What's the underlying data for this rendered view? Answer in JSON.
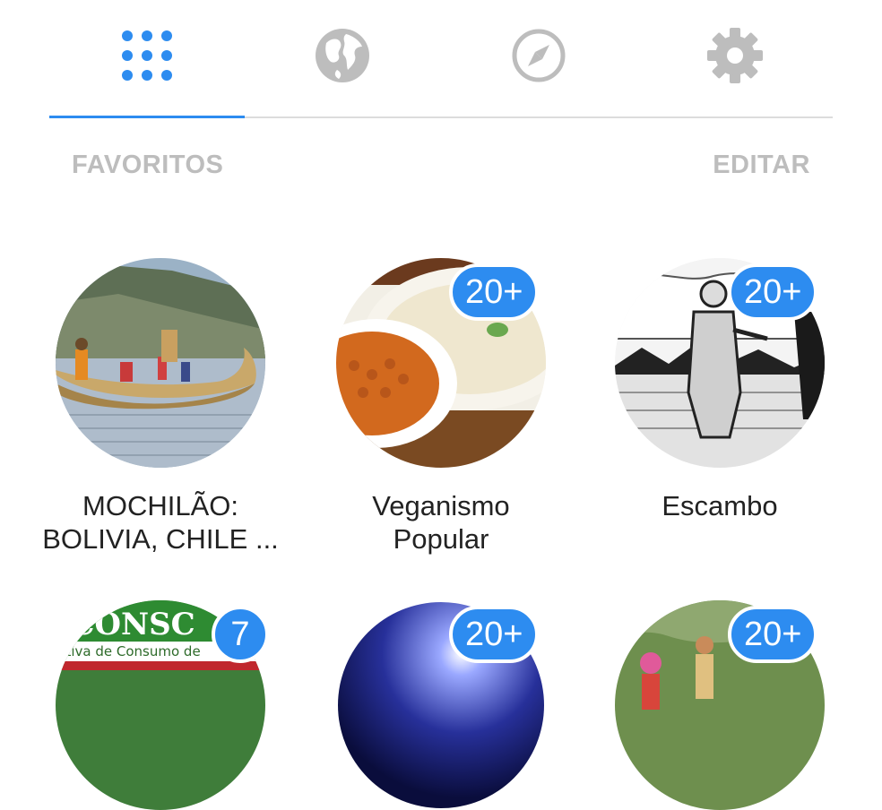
{
  "tabs": [
    {
      "name": "apps",
      "icon": "grid-icon",
      "active": true
    },
    {
      "name": "globe",
      "icon": "globe-icon",
      "active": false
    },
    {
      "name": "compass",
      "icon": "compass-icon",
      "active": false
    },
    {
      "name": "settings",
      "icon": "gear-icon",
      "active": false
    }
  ],
  "colors": {
    "accent": "#2d8cf0",
    "inactive_icon": "#bdbdbd",
    "section_header": "#bdbdbd",
    "text": "#222222"
  },
  "section": {
    "title": "FAVORITOS",
    "edit_label": "EDITAR"
  },
  "groups": [
    {
      "name": "MOCHILÃO:\nBOLIVIA, CHILE ...",
      "badge": ""
    },
    {
      "name": "Veganismo\nPopular",
      "badge": "20+"
    },
    {
      "name": "Escambo",
      "badge": "20+"
    },
    {
      "name": "",
      "badge": "7",
      "image_text": "CONSC",
      "image_subtext": "ativa de Consumo de"
    },
    {
      "name": "",
      "badge": "20+"
    },
    {
      "name": "",
      "badge": "20+"
    }
  ]
}
